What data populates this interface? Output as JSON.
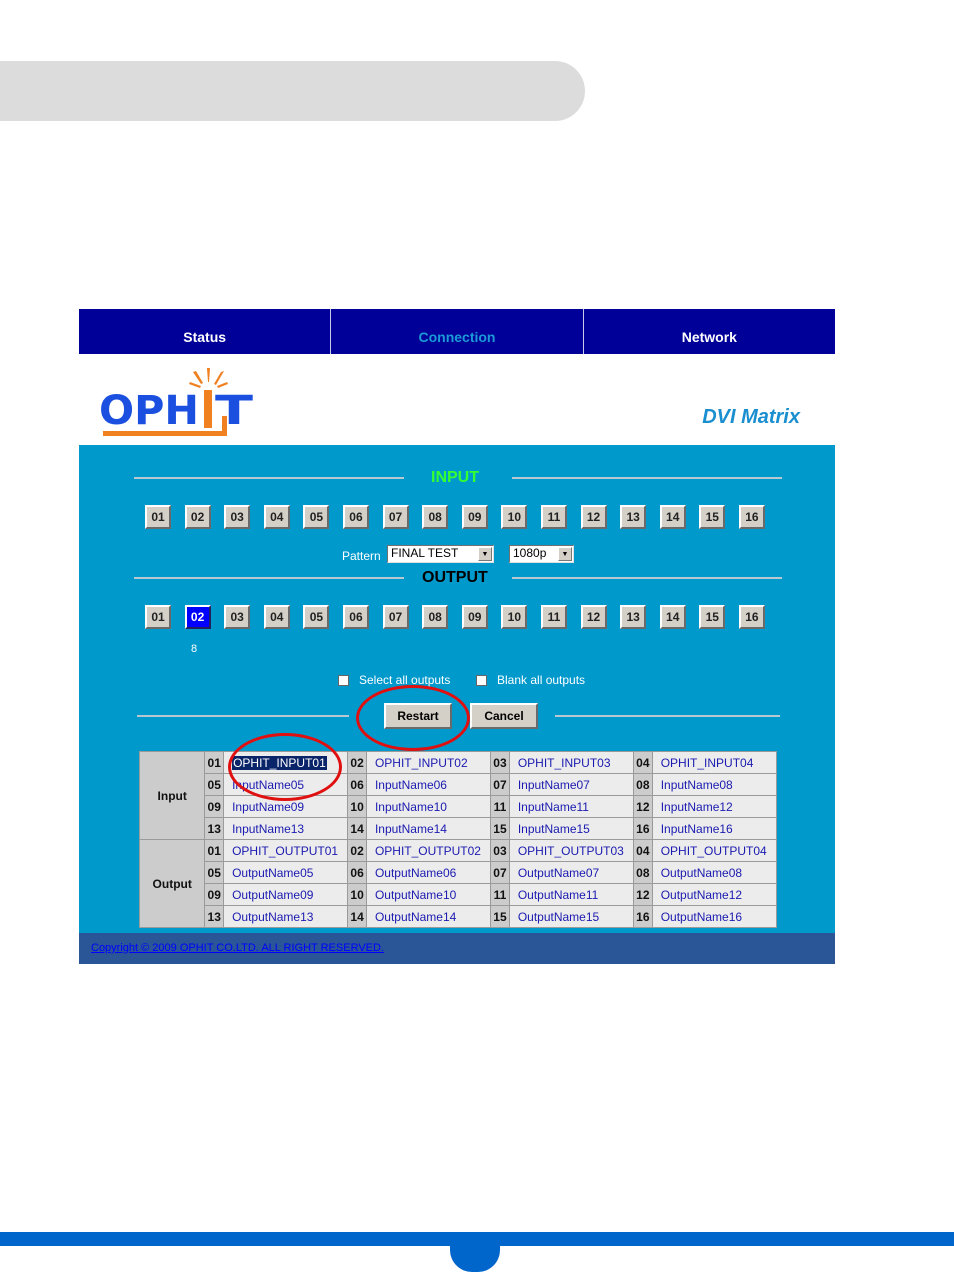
{
  "nav": {
    "tabs": [
      {
        "label": "Status",
        "active": false
      },
      {
        "label": "Connection",
        "active": true
      },
      {
        "label": "Network",
        "active": false
      }
    ]
  },
  "header": {
    "logo_text": "OPHIT",
    "product": "DVI Matrix"
  },
  "input_section": {
    "title": "INPUT",
    "title_color": "#33ff33",
    "buttons": [
      "01",
      "02",
      "03",
      "04",
      "05",
      "06",
      "07",
      "08",
      "09",
      "10",
      "11",
      "12",
      "13",
      "14",
      "15",
      "16"
    ],
    "pattern_label": "Pattern",
    "pattern_value": "FINAL TEST",
    "resolution_value": "1080p"
  },
  "output_section": {
    "title": "OUTPUT",
    "buttons": [
      "01",
      "02",
      "03",
      "04",
      "05",
      "06",
      "07",
      "08",
      "09",
      "10",
      "11",
      "12",
      "13",
      "14",
      "15",
      "16"
    ],
    "selected": "02",
    "selected_input_indicator": "8",
    "select_all_label": "Select all outputs",
    "blank_all_label": "Blank all outputs",
    "restart_label": "Restart",
    "cancel_label": "Cancel"
  },
  "names_table": {
    "input_label": "Input",
    "output_label": "Output",
    "inputs": [
      [
        {
          "idx": "01",
          "name": "OPHIT_INPUT01"
        },
        {
          "idx": "02",
          "name": "OPHIT_INPUT02"
        },
        {
          "idx": "03",
          "name": "OPHIT_INPUT03"
        },
        {
          "idx": "04",
          "name": "OPHIT_INPUT04"
        }
      ],
      [
        {
          "idx": "05",
          "name": "InputName05"
        },
        {
          "idx": "06",
          "name": "InputName06"
        },
        {
          "idx": "07",
          "name": "InputName07"
        },
        {
          "idx": "08",
          "name": "InputName08"
        }
      ],
      [
        {
          "idx": "09",
          "name": "InputName09"
        },
        {
          "idx": "10",
          "name": "InputName10"
        },
        {
          "idx": "11",
          "name": "InputName11"
        },
        {
          "idx": "12",
          "name": "InputName12"
        }
      ],
      [
        {
          "idx": "13",
          "name": "InputName13"
        },
        {
          "idx": "14",
          "name": "InputName14"
        },
        {
          "idx": "15",
          "name": "InputName15"
        },
        {
          "idx": "16",
          "name": "InputName16"
        }
      ]
    ],
    "outputs": [
      [
        {
          "idx": "01",
          "name": "OPHIT_OUTPUT01"
        },
        {
          "idx": "02",
          "name": "OPHIT_OUTPUT02"
        },
        {
          "idx": "03",
          "name": "OPHIT_OUTPUT03"
        },
        {
          "idx": "04",
          "name": "OPHIT_OUTPUT04"
        }
      ],
      [
        {
          "idx": "05",
          "name": "OutputName05"
        },
        {
          "idx": "06",
          "name": "OutputName06"
        },
        {
          "idx": "07",
          "name": "OutputName07"
        },
        {
          "idx": "08",
          "name": "OutputName08"
        }
      ],
      [
        {
          "idx": "09",
          "name": "OutputName09"
        },
        {
          "idx": "10",
          "name": "OutputName10"
        },
        {
          "idx": "11",
          "name": "OutputName11"
        },
        {
          "idx": "12",
          "name": "OutputName12"
        }
      ],
      [
        {
          "idx": "13",
          "name": "OutputName13"
        },
        {
          "idx": "14",
          "name": "OutputName14"
        },
        {
          "idx": "15",
          "name": "OutputName15"
        },
        {
          "idx": "16",
          "name": "OutputName16"
        }
      ]
    ]
  },
  "footer": {
    "copyright": "Copyright © 2009 OPHIT CO.LTD. ALL RIGHT RESERVED."
  }
}
